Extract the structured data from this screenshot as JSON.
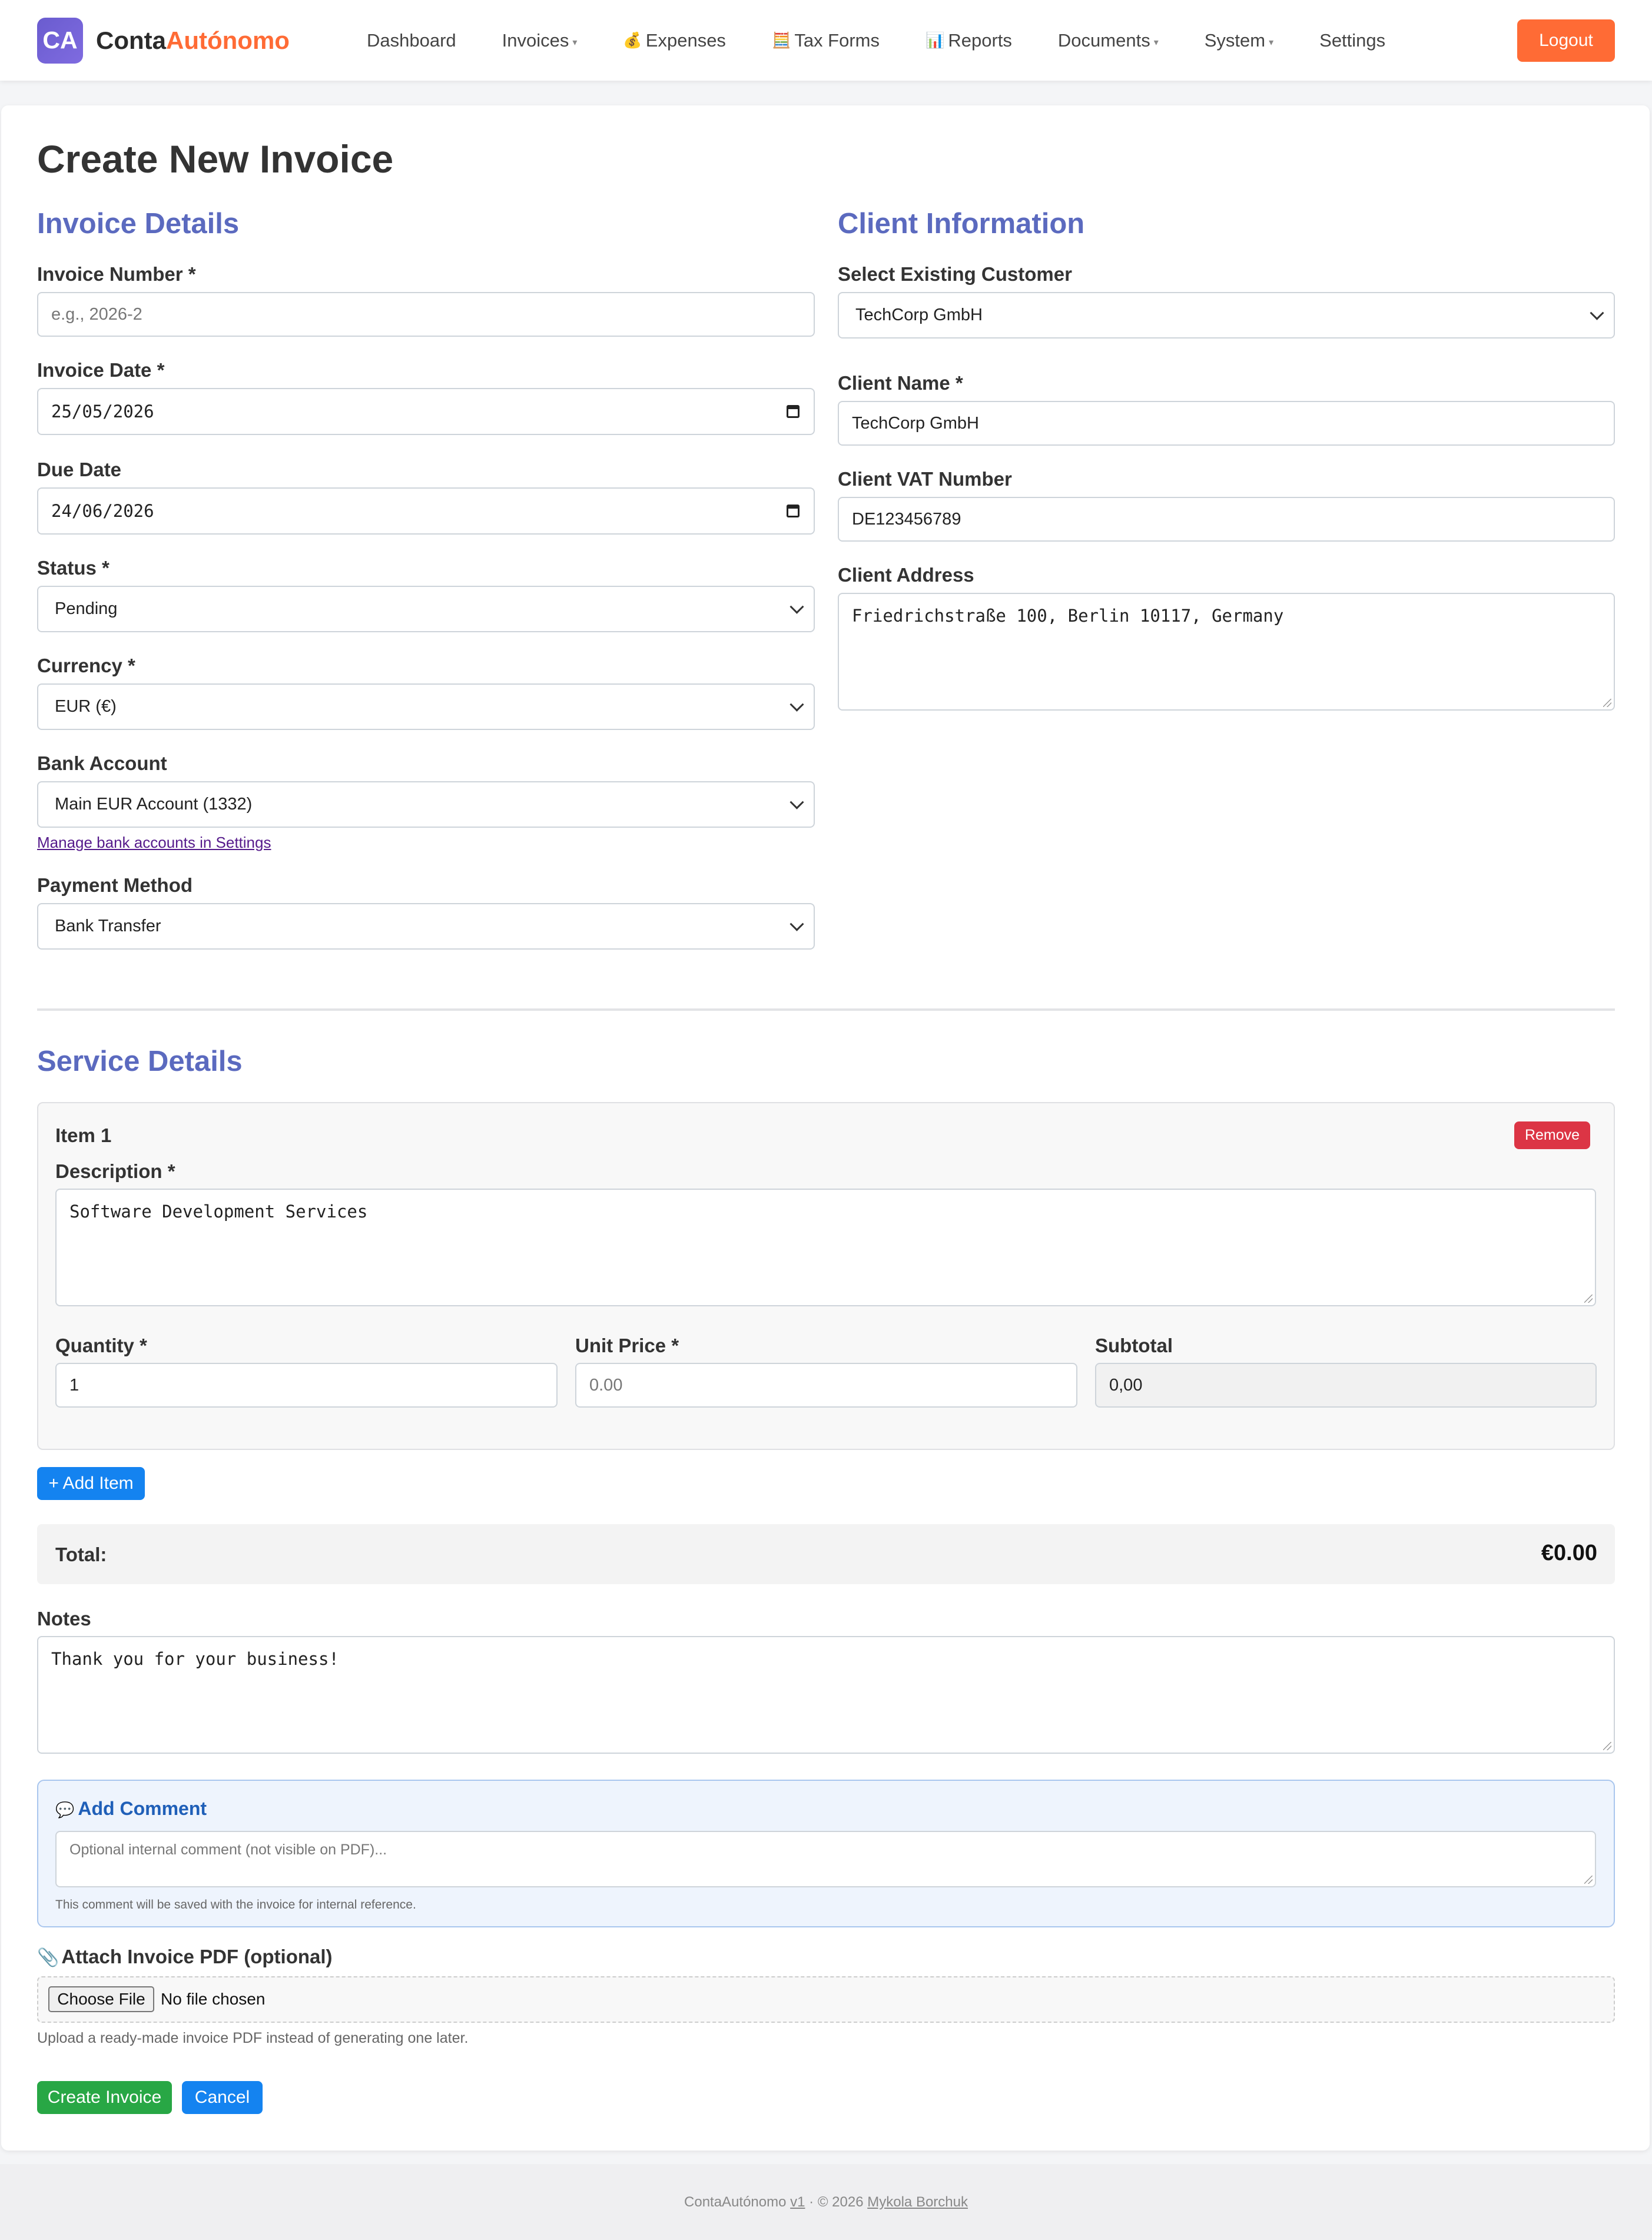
{
  "nav": {
    "brand_initials": "CA",
    "brand_name_part1": "Conta",
    "brand_name_part2": "Autónomo",
    "items": [
      {
        "label": "Dashboard"
      },
      {
        "label": "Invoices"
      },
      {
        "label": "Expenses"
      },
      {
        "label": "Tax Forms"
      },
      {
        "label": "Reports"
      },
      {
        "label": "Documents"
      },
      {
        "label": "System"
      },
      {
        "label": "Settings"
      }
    ],
    "logout_label": "Logout"
  },
  "page": {
    "title": "Create New Invoice"
  },
  "invoice_details": {
    "heading": "Invoice Details",
    "invoice_number": {
      "label": "Invoice Number *",
      "placeholder": "e.g., 2026-2"
    },
    "invoice_date": {
      "label": "Invoice Date *",
      "value": "25/05/2026"
    },
    "due_date": {
      "label": "Due Date",
      "value": "24/06/2026"
    },
    "status": {
      "label": "Status *",
      "value": "Pending"
    },
    "currency": {
      "label": "Currency *",
      "value": "EUR (€)"
    },
    "bank_account": {
      "label": "Bank Account",
      "value": "Main EUR Account (1332)",
      "manage_link": "Manage bank accounts in Settings"
    },
    "payment_method": {
      "label": "Payment Method",
      "value": "Bank Transfer"
    }
  },
  "client_info": {
    "heading": "Client Information",
    "existing_customer": {
      "label": "Select Existing Customer",
      "value": "TechCorp GmbH"
    },
    "client_name": {
      "label": "Client Name *",
      "value": "TechCorp GmbH"
    },
    "client_vat": {
      "label": "Client VAT Number",
      "value": "DE123456789"
    },
    "client_address": {
      "label": "Client Address",
      "value": "Friedrichstraße 100, Berlin 10117, Germany"
    }
  },
  "service_details": {
    "heading": "Service Details",
    "item": {
      "title": "Item 1",
      "remove_label": "Remove",
      "description": {
        "label": "Description *",
        "value": "Software Development Services"
      },
      "quantity": {
        "label": "Quantity *",
        "value": "1"
      },
      "unit_price": {
        "label": "Unit Price *",
        "placeholder": "0.00"
      },
      "subtotal": {
        "label": "Subtotal",
        "value": "0,00"
      }
    },
    "add_item_label": "+ Add Item"
  },
  "total": {
    "label": "Total:",
    "value": "€0.00"
  },
  "notes": {
    "label": "Notes",
    "value": "Thank you for your business!"
  },
  "comment": {
    "title": "Add Comment",
    "placeholder": "Optional internal comment (not visible on PDF)...",
    "helper": "This comment will be saved with the invoice for internal reference."
  },
  "attach": {
    "label": "Attach Invoice PDF (optional)",
    "choose_label": "Choose File",
    "status": "No file chosen",
    "helper": "Upload a ready-made invoice PDF instead of generating one later."
  },
  "actions": {
    "create_label": "Create Invoice",
    "cancel_label": "Cancel"
  },
  "footer": {
    "app_name": "ContaAutónomo",
    "version": "v1",
    "separator": "· © 2026",
    "author": "Mykola Borchuk"
  },
  "colors": {
    "accent": "#ff6b35",
    "section_heading": "#5b6abf",
    "primary": "#1483f0",
    "danger": "#dc3545",
    "success": "#28a745"
  },
  "icons": {
    "expenses": "money-bag-icon",
    "tax_forms": "abacus-icon",
    "reports": "bar-chart-icon",
    "comment": "speech-bubble-icon",
    "attach": "paperclip-icon"
  }
}
